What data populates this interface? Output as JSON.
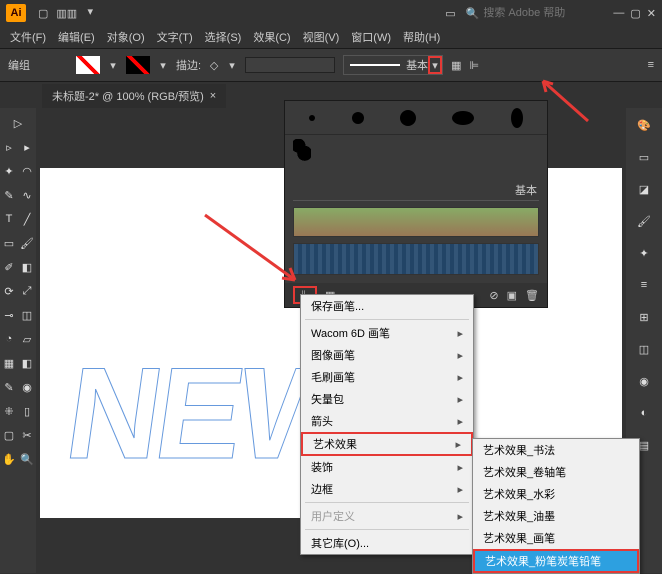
{
  "title_search_placeholder": "搜索 Adobe 帮助",
  "menus": [
    "文件(F)",
    "编辑(E)",
    "对象(O)",
    "文字(T)",
    "选择(S)",
    "效果(C)",
    "视图(V)",
    "窗口(W)",
    "帮助(H)"
  ],
  "ctrl": {
    "group": "编组",
    "stroke_label": "描边:",
    "basic": "基本"
  },
  "tab": {
    "title": "未标题-2* @ 100% (RGB/预览)"
  },
  "brush_panel": {
    "basic": "基本"
  },
  "menu_items": {
    "save": "保存画笔...",
    "wacom": "Wacom 6D 画笔",
    "image": "图像画笔",
    "bristle": "毛刷画笔",
    "vector": "矢量包",
    "arrows": "箭头",
    "art": "艺术效果",
    "deco": "装饰",
    "border": "边框",
    "userdef": "用户定义",
    "other": "其它库(O)..."
  },
  "submenus": {
    "calli": "艺术效果_书法",
    "scroll": "艺术效果_卷轴笔",
    "water": "艺术效果_水彩",
    "ink": "艺术效果_油墨",
    "paint": "艺术效果_画笔",
    "chalk": "艺术效果_粉笔炭笔铅笔"
  },
  "canvas_text": "NEW"
}
